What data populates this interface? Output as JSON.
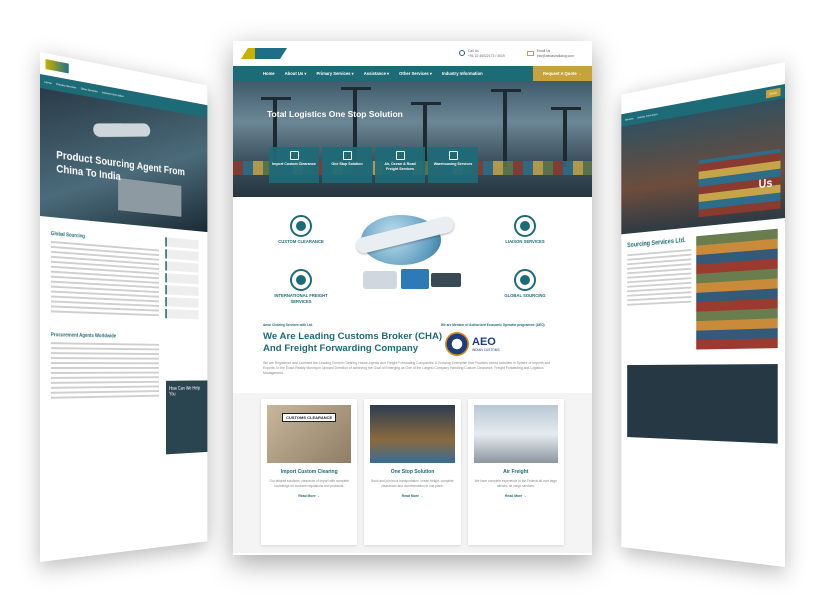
{
  "left_page": {
    "hero_title": "Product Sourcing Agent From China To India",
    "section_title": "Global Sourcing",
    "section_title_2": "Procurement Agents Worldwide",
    "help_text": "How Can We Help You"
  },
  "right_page": {
    "hero_title": "Us",
    "section_title": "Sourcing Services Ltd."
  },
  "main": {
    "header": {
      "phone_label": "Call Us",
      "phone": "+91 22 40022173 / 4019",
      "email_label": "Email Us",
      "email": "info@aeoasindialog.com"
    },
    "nav": {
      "items": [
        "Home",
        "About Us ▾",
        "Primary Services ▾",
        "Assistance ▾",
        "Other Services ▾",
        "Industry Information"
      ],
      "quote": "Request A Quote →"
    },
    "hero": {
      "title": "Total Logistics One Stop Solution",
      "services": [
        {
          "label": "Import Custom Clearance"
        },
        {
          "label": "One Stop Solution"
        },
        {
          "label": "Air, Ocean & Road Freight Services"
        },
        {
          "label": "Warehousing Services"
        }
      ]
    },
    "features": {
      "custom_clearance": "CUSTOM CLEARANCE",
      "international_freight": "INTERNATIONAL FREIGHT SERVICES",
      "liaison": "LIAISON SERVICES",
      "global_sourcing": "GLOBAL SOURCING"
    },
    "about": {
      "eyebrow": "Amar Clearing Services with Ltd.",
      "title": "We Are Leading Customs Broker (CHA) And Freight Forwarding Company",
      "aeo_label": "We are Member of Authorized Economic Operator programme (AEO)",
      "aeo_big": "AEO",
      "aeo_sub": "INDIAN CUSTOMS",
      "body": "We are Registered and Licensed the Leading Custom Clearing House Agents and Freight Forwarding Companies. A Growing Enterprise that Provides varied Activities in Sphere of Imports and Exports. In the Exact Reality Moving in Upward Direction of achieving the Goal of Emerging as One of the Largest Company Handling Custom Clearance, Freight Forwarding and Logistics Management."
    },
    "cards": [
      {
        "title": "Import Custom Clearing",
        "text": "Our tailored solutions, clearance of import with complete knowledge on customs regulations and protocols.",
        "link": "Read More →",
        "stamp": "CUSTOMS CLEARANCE"
      },
      {
        "title": "One Stop Solution",
        "text": "Book and join truck transportation, ocean freight, complete clearances and documentation in one place.",
        "link": "Read More →"
      },
      {
        "title": "Air Freight",
        "text": "We have complete experience in the Federal all over large airlines, air cargo services.",
        "link": "Read More →"
      }
    ]
  }
}
